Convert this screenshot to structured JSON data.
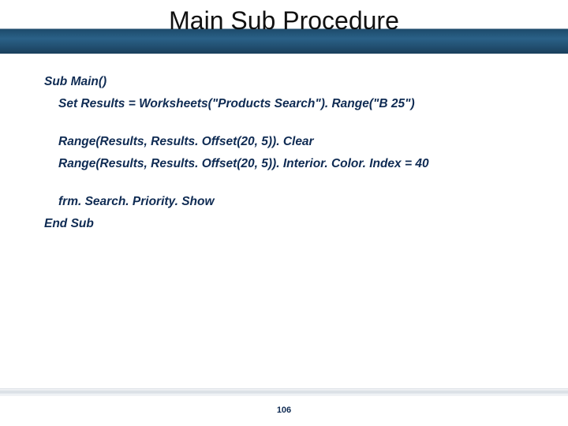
{
  "title": "Main Sub Procedure",
  "code": {
    "l1": "Sub Main()",
    "l2": "Set Results = Worksheets(\"Products Search\"). Range(\"B 25\")",
    "l3": "Range(Results, Results. Offset(20, 5)). Clear",
    "l4": "Range(Results, Results. Offset(20, 5)). Interior. Color. Index = 40",
    "l5": "frm. Search. Priority. Show",
    "l6": "End Sub"
  },
  "page_number": "106"
}
